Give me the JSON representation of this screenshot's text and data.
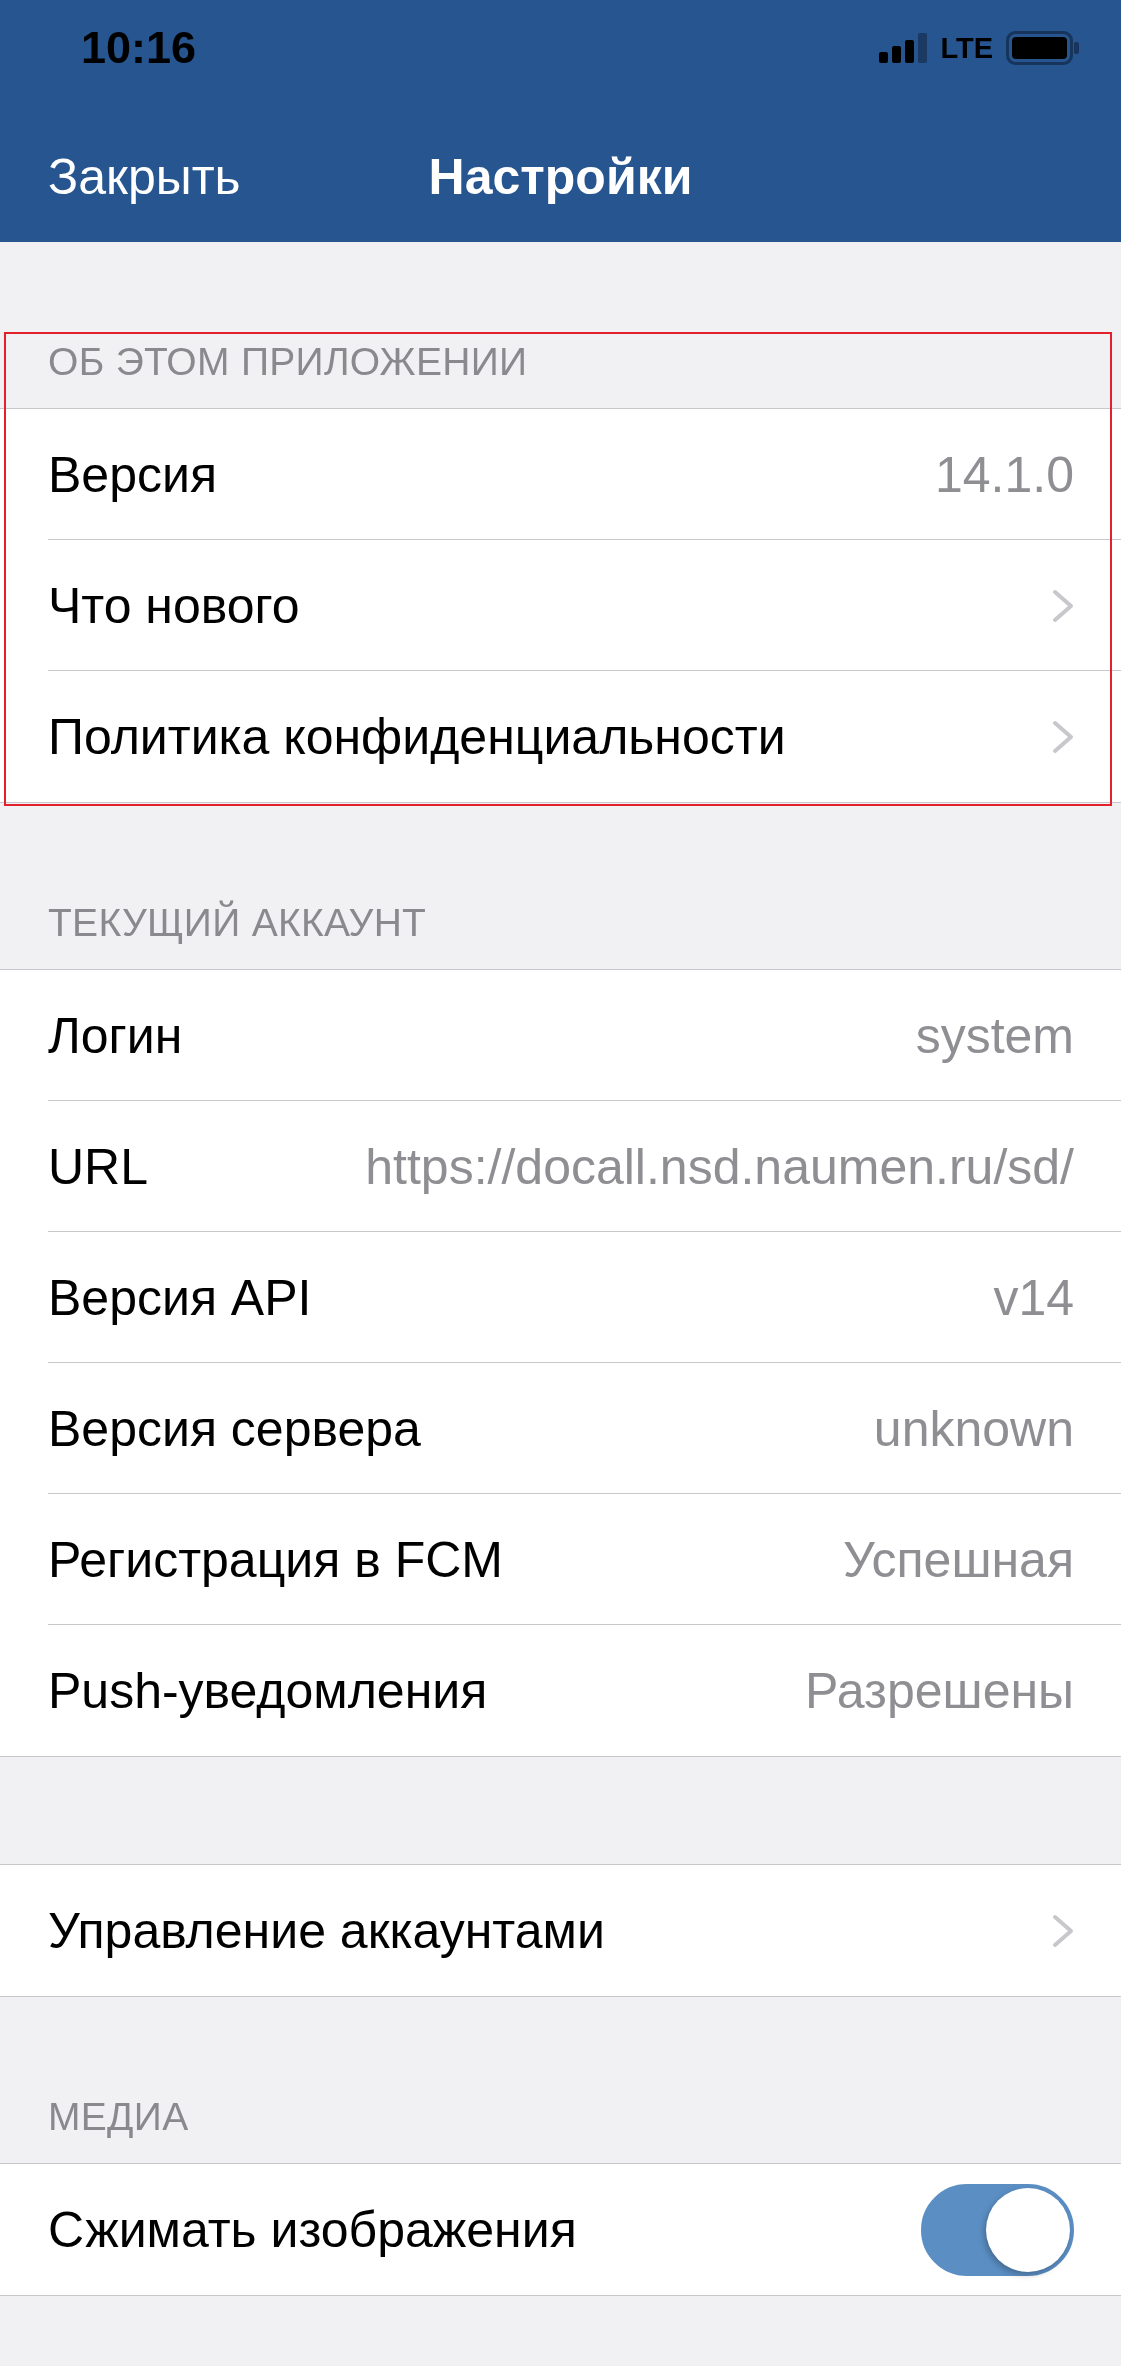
{
  "status_bar": {
    "time": "10:16",
    "network": "LTE"
  },
  "nav_bar": {
    "left_button": "Закрыть",
    "title": "Настройки"
  },
  "sections": [
    {
      "header": "ОБ ЭТОМ ПРИЛОЖЕНИИ",
      "highlighted": true,
      "rows": [
        {
          "kind": "value",
          "label": "Версия",
          "value": "14.1.0"
        },
        {
          "kind": "link",
          "label": "Что нового"
        },
        {
          "kind": "link",
          "label": "Политика конфиденциальности"
        }
      ]
    },
    {
      "header": "ТЕКУЩИЙ АККАУНТ",
      "highlighted": false,
      "rows": [
        {
          "kind": "value",
          "label": "Логин",
          "value": "system"
        },
        {
          "kind": "value",
          "label": "URL",
          "value": "https://docall.nsd.naumen.ru/sd/"
        },
        {
          "kind": "value",
          "label": "Версия API",
          "value": "v14"
        },
        {
          "kind": "value",
          "label": "Версия сервера",
          "value": "unknown"
        },
        {
          "kind": "value",
          "label": "Регистрация в FCM",
          "value": "Успешная"
        },
        {
          "kind": "value",
          "label": "Push-уведомления",
          "value": "Разрешены"
        }
      ]
    },
    {
      "highlighted": false,
      "rows": [
        {
          "kind": "link",
          "label": "Управление аккаунтами"
        }
      ]
    },
    {
      "header": "МЕДИА",
      "highlighted": false,
      "rows": [
        {
          "kind": "toggle",
          "label": "Сжимать изображения",
          "on": true
        }
      ]
    }
  ]
}
